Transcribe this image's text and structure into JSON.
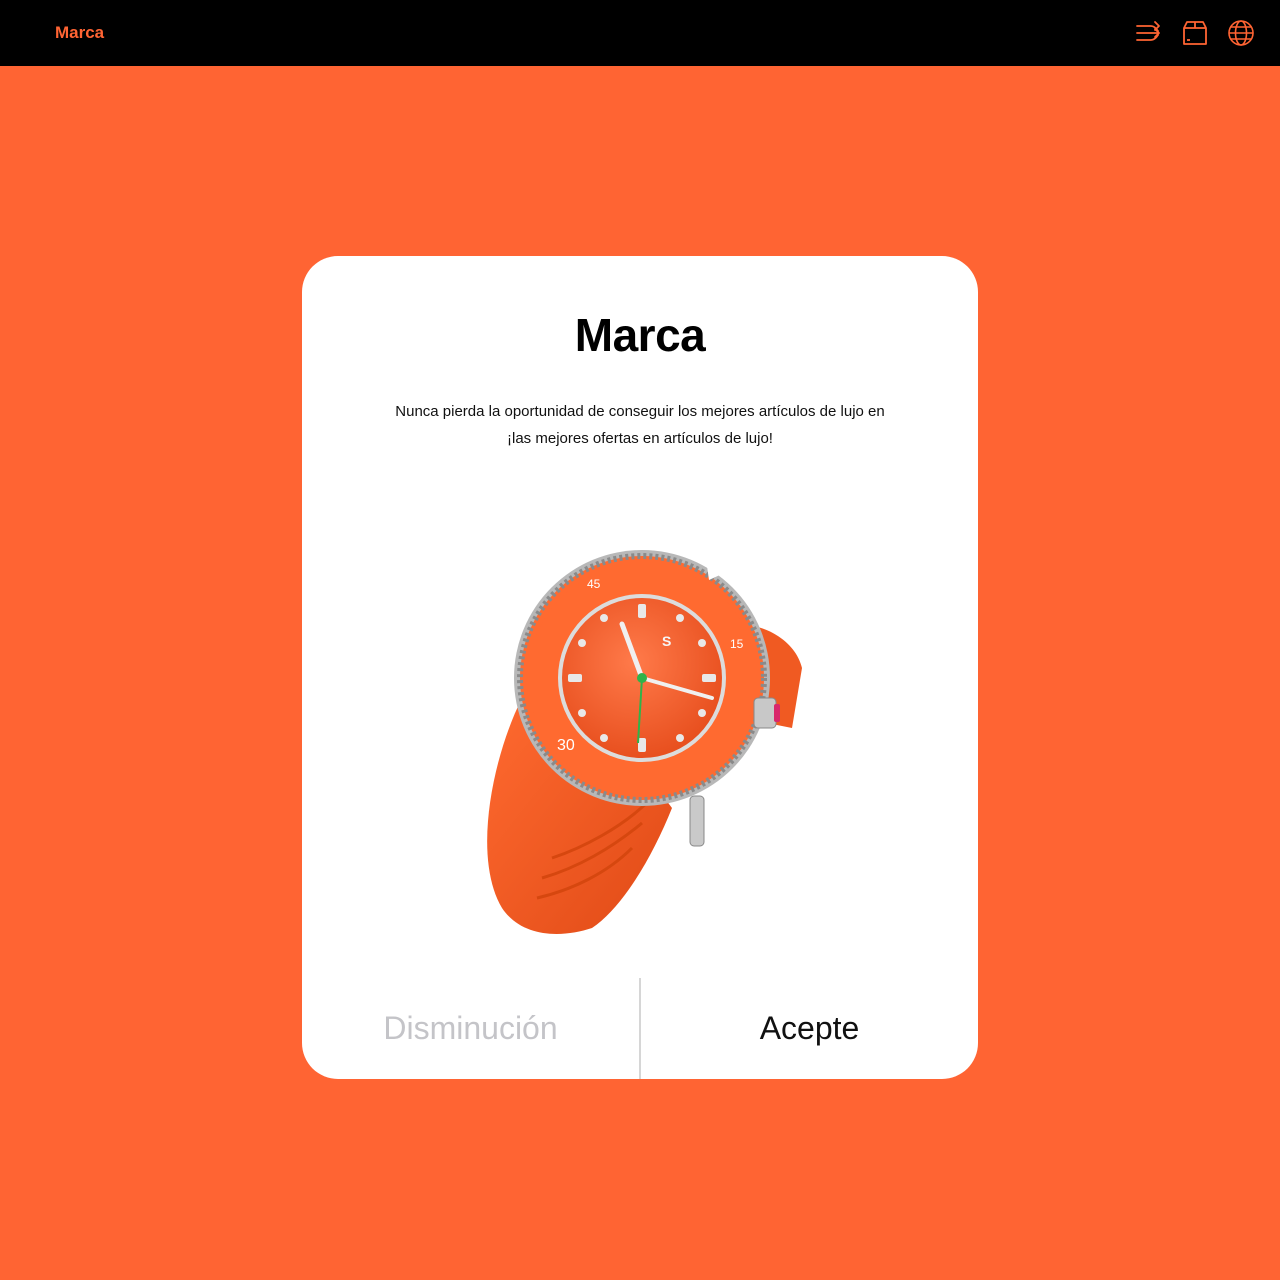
{
  "header": {
    "brand": "Marca",
    "icons": [
      "shuffle-icon",
      "box-icon",
      "globe-icon"
    ]
  },
  "modal": {
    "title": "Marca",
    "description_line1": "Nunca pierda la oportunidad de conseguir los mejores artículos de lujo en",
    "description_line2": "¡las mejores ofertas en artículos de lujo!",
    "decline_label": "Disminución",
    "accept_label": "Acepte"
  },
  "colors": {
    "background": "#ff6433",
    "topbar": "#000000",
    "accent": "#ff6433",
    "card": "#ffffff",
    "decline_text": "#c4c4c8"
  }
}
